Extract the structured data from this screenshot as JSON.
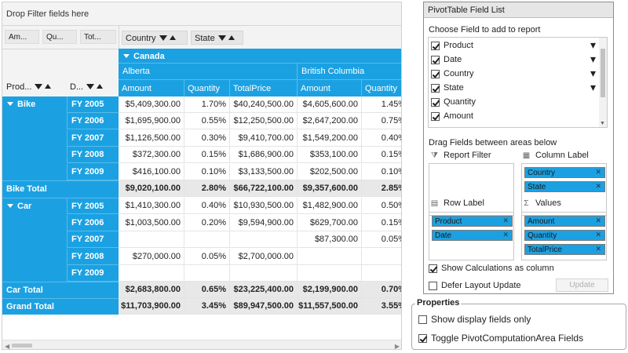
{
  "grid": {
    "filter_placeholder": "Drop Filter fields here",
    "value_buttons": [
      "Am...",
      "Qu...",
      "Tot..."
    ],
    "column_fields": [
      "Country",
      "State"
    ],
    "row_fields": [
      "Prod...",
      "D..."
    ],
    "column_header": {
      "country": "Canada",
      "provinces": [
        "Alberta",
        "British Columbia"
      ],
      "measures": [
        "Amount",
        "Quantity",
        "TotalPrice",
        "Amount",
        "Quantity"
      ]
    },
    "rows": [
      {
        "product": "Bike",
        "date": "FY 2005",
        "values": [
          "$5,409,300.00",
          "1.70%",
          "$40,240,500.00",
          "$4,605,600.00",
          "1.45%"
        ]
      },
      {
        "product": "",
        "date": "FY 2006",
        "values": [
          "$1,695,900.00",
          "0.55%",
          "$12,250,500.00",
          "$2,647,200.00",
          "0.75%"
        ]
      },
      {
        "product": "",
        "date": "FY 2007",
        "values": [
          "$1,126,500.00",
          "0.30%",
          "$9,410,700.00",
          "$1,549,200.00",
          "0.40%"
        ]
      },
      {
        "product": "",
        "date": "FY 2008",
        "values": [
          "$372,300.00",
          "0.15%",
          "$1,686,900.00",
          "$353,100.00",
          "0.15%"
        ]
      },
      {
        "product": "",
        "date": "FY 2009",
        "values": [
          "$416,100.00",
          "0.10%",
          "$3,133,500.00",
          "$202,500.00",
          "0.10%"
        ]
      },
      {
        "total": "Bike Total",
        "values": [
          "$9,020,100.00",
          "2.80%",
          "$66,722,100.00",
          "$9,357,600.00",
          "2.85%"
        ]
      },
      {
        "product": "Car",
        "date": "FY 2005",
        "values": [
          "$1,410,300.00",
          "0.40%",
          "$10,930,500.00",
          "$1,482,900.00",
          "0.50%"
        ]
      },
      {
        "product": "",
        "date": "FY 2006",
        "values": [
          "$1,003,500.00",
          "0.20%",
          "$9,594,900.00",
          "$629,700.00",
          "0.15%"
        ]
      },
      {
        "product": "",
        "date": "FY 2007",
        "values": [
          "",
          "",
          "",
          "$87,300.00",
          "0.05%"
        ]
      },
      {
        "product": "",
        "date": "FY 2008",
        "values": [
          "$270,000.00",
          "0.05%",
          "$2,700,000.00",
          "",
          ""
        ]
      },
      {
        "product": "",
        "date": "FY 2009",
        "values": [
          "",
          "",
          "",
          "",
          ""
        ]
      },
      {
        "total": "Car Total",
        "values": [
          "$2,683,800.00",
          "0.65%",
          "$23,225,400.00",
          "$2,199,900.00",
          "0.70%"
        ]
      },
      {
        "total": "Grand Total",
        "values": [
          "$11,703,900.00",
          "3.45%",
          "$89,947,500.00",
          "$11,557,500.00",
          "3.55%"
        ]
      }
    ]
  },
  "field_list": {
    "title": "PivotTable Field List",
    "choose_label": "Choose Field to add to report",
    "fields": [
      {
        "label": "Product",
        "checked": true,
        "dropdown": true
      },
      {
        "label": "Date",
        "checked": true,
        "dropdown": true
      },
      {
        "label": "Country",
        "checked": true,
        "dropdown": true
      },
      {
        "label": "State",
        "checked": true,
        "dropdown": true
      },
      {
        "label": "Quantity",
        "checked": true,
        "dropdown": false
      },
      {
        "label": "Amount",
        "checked": true,
        "dropdown": false
      }
    ],
    "drag_label": "Drag Fields between areas below",
    "report_filter_label": "Report Filter",
    "column_label_title": "Column Label",
    "row_label_title": "Row Label",
    "values_title": "Values",
    "column_chips": [
      "Country",
      "State"
    ],
    "row_chips": [
      "Product",
      "Date"
    ],
    "value_chips": [
      "Amount",
      "Quantity",
      "TotalPrice"
    ],
    "show_calc_label": "Show Calculations as column",
    "show_calc_checked": true,
    "defer_label": "Defer Layout Update",
    "defer_checked": false,
    "update_label": "Update"
  },
  "properties": {
    "legend": "Properties",
    "show_display_label": "Show display fields only",
    "show_display_checked": false,
    "toggle_label": "Toggle PivotComputationArea Fields",
    "toggle_checked": true
  },
  "colors": {
    "accent": "#1ba1e2",
    "total_row_bg": "#e8e8e8",
    "header_bg": "#f3f3f3"
  },
  "icons": {
    "filter": "funnel-icon",
    "sort": "sort-asc-icon",
    "expand": "collapse-triangle-icon",
    "close": "close-x-icon"
  }
}
